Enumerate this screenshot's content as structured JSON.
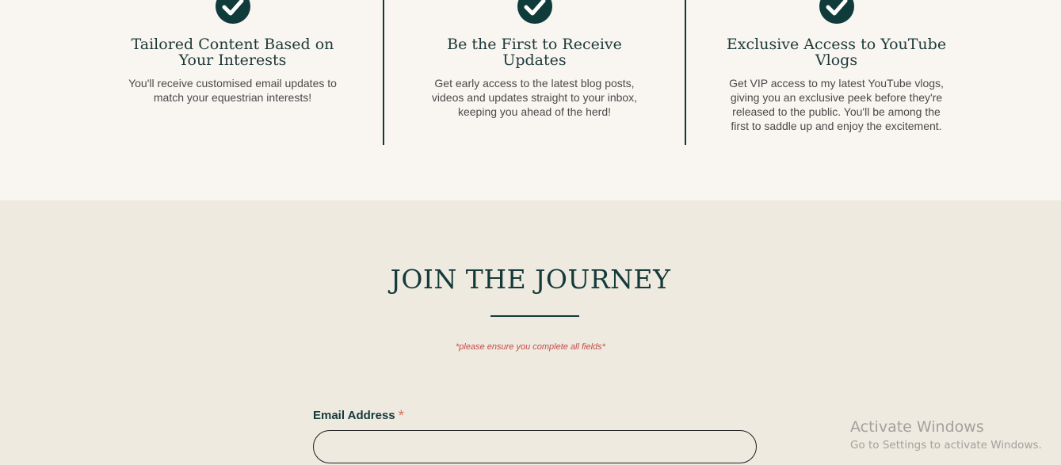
{
  "features": [
    {
      "icon": "check-circle-icon",
      "title_lines": [
        "Tailored Content Based on",
        "Your Interests"
      ],
      "desc_lines": [
        "You'll receive customised email updates to",
        "match your equestrian interests!"
      ]
    },
    {
      "icon": "check-circle-icon",
      "title_lines": [
        "Be the First to Receive",
        "Updates"
      ],
      "desc_lines": [
        "Get early access to the latest blog posts,",
        "videos and updates straight to your inbox,",
        "keeping you ahead of the herd!"
      ]
    },
    {
      "icon": "check-circle-icon",
      "title_lines": [
        "Exclusive Access to YouTube",
        "Vlogs"
      ],
      "desc_lines": [
        "Get VIP access to my latest YouTube vlogs,",
        "giving you an exclusive peek before they're",
        "released to the public. You'll be among the",
        "first to saddle up and enjoy the excitement."
      ]
    }
  ],
  "signup": {
    "heading": "JOIN THE JOURNEY",
    "note": "*please ensure you complete all fields*",
    "email_label": "Email Address",
    "required_mark": "*",
    "email_value": ""
  },
  "watermark": {
    "title": "Activate Windows",
    "subtitle": "Go to Settings to activate Windows."
  },
  "colors": {
    "top_background": "#f9f5f1",
    "bottom_background": "#eeeae0",
    "accent_dark_teal": "#0f3b3a",
    "required_accent": "#d97360",
    "note_red": "#c64a4a"
  }
}
